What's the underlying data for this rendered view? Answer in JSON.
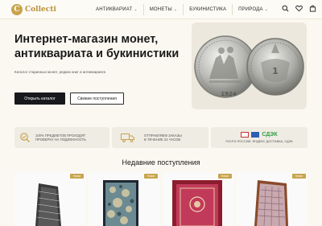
{
  "header": {
    "logo_letter": "C",
    "logo_text": "Collecti",
    "nav": [
      {
        "label": "АНТИКВАРИАТ",
        "has_dropdown": true
      },
      {
        "label": "МОНЕТЫ",
        "has_dropdown": true
      },
      {
        "label": "БУКИНИСТИКА",
        "has_dropdown": false
      },
      {
        "label": "ПРИРОДА",
        "has_dropdown": true
      }
    ],
    "icons": [
      "search-icon",
      "heart-icon",
      "cart-icon"
    ]
  },
  "hero": {
    "title": "Интернет-магазин монет, антиквариата и букинистики",
    "subtitle": "Каталог старинных монет, редких книг и антиквариата",
    "primary_button": "Открыть каталог",
    "secondary_button": "Свежие поступления",
    "coin_year": "1924"
  },
  "features": [
    {
      "icon": "magnifier-check-icon",
      "line1": "100% предметов проходят",
      "line2": "проверку на подлинность"
    },
    {
      "icon": "truck-icon",
      "line1": "Отправляем заказы",
      "line2": "в течение 24 часов"
    },
    {
      "icon": "payment-logos-icon",
      "line1": "",
      "line2": "Почта России, Яндекс доставка, СДЭК",
      "logo_text": "СДЭК"
    }
  ],
  "new_arrivals": {
    "title": "Недавние поступления",
    "badge_label": "Новое",
    "items": [
      {
        "color": "#e7e7e7"
      },
      {
        "color": "#6b8a92"
      },
      {
        "color": "#c23a5a"
      },
      {
        "color": "#a6b8c7"
      }
    ]
  },
  "colors": {
    "accent": "#c9a44c",
    "background": "#fbf8f1",
    "dark_button": "#17191c"
  }
}
